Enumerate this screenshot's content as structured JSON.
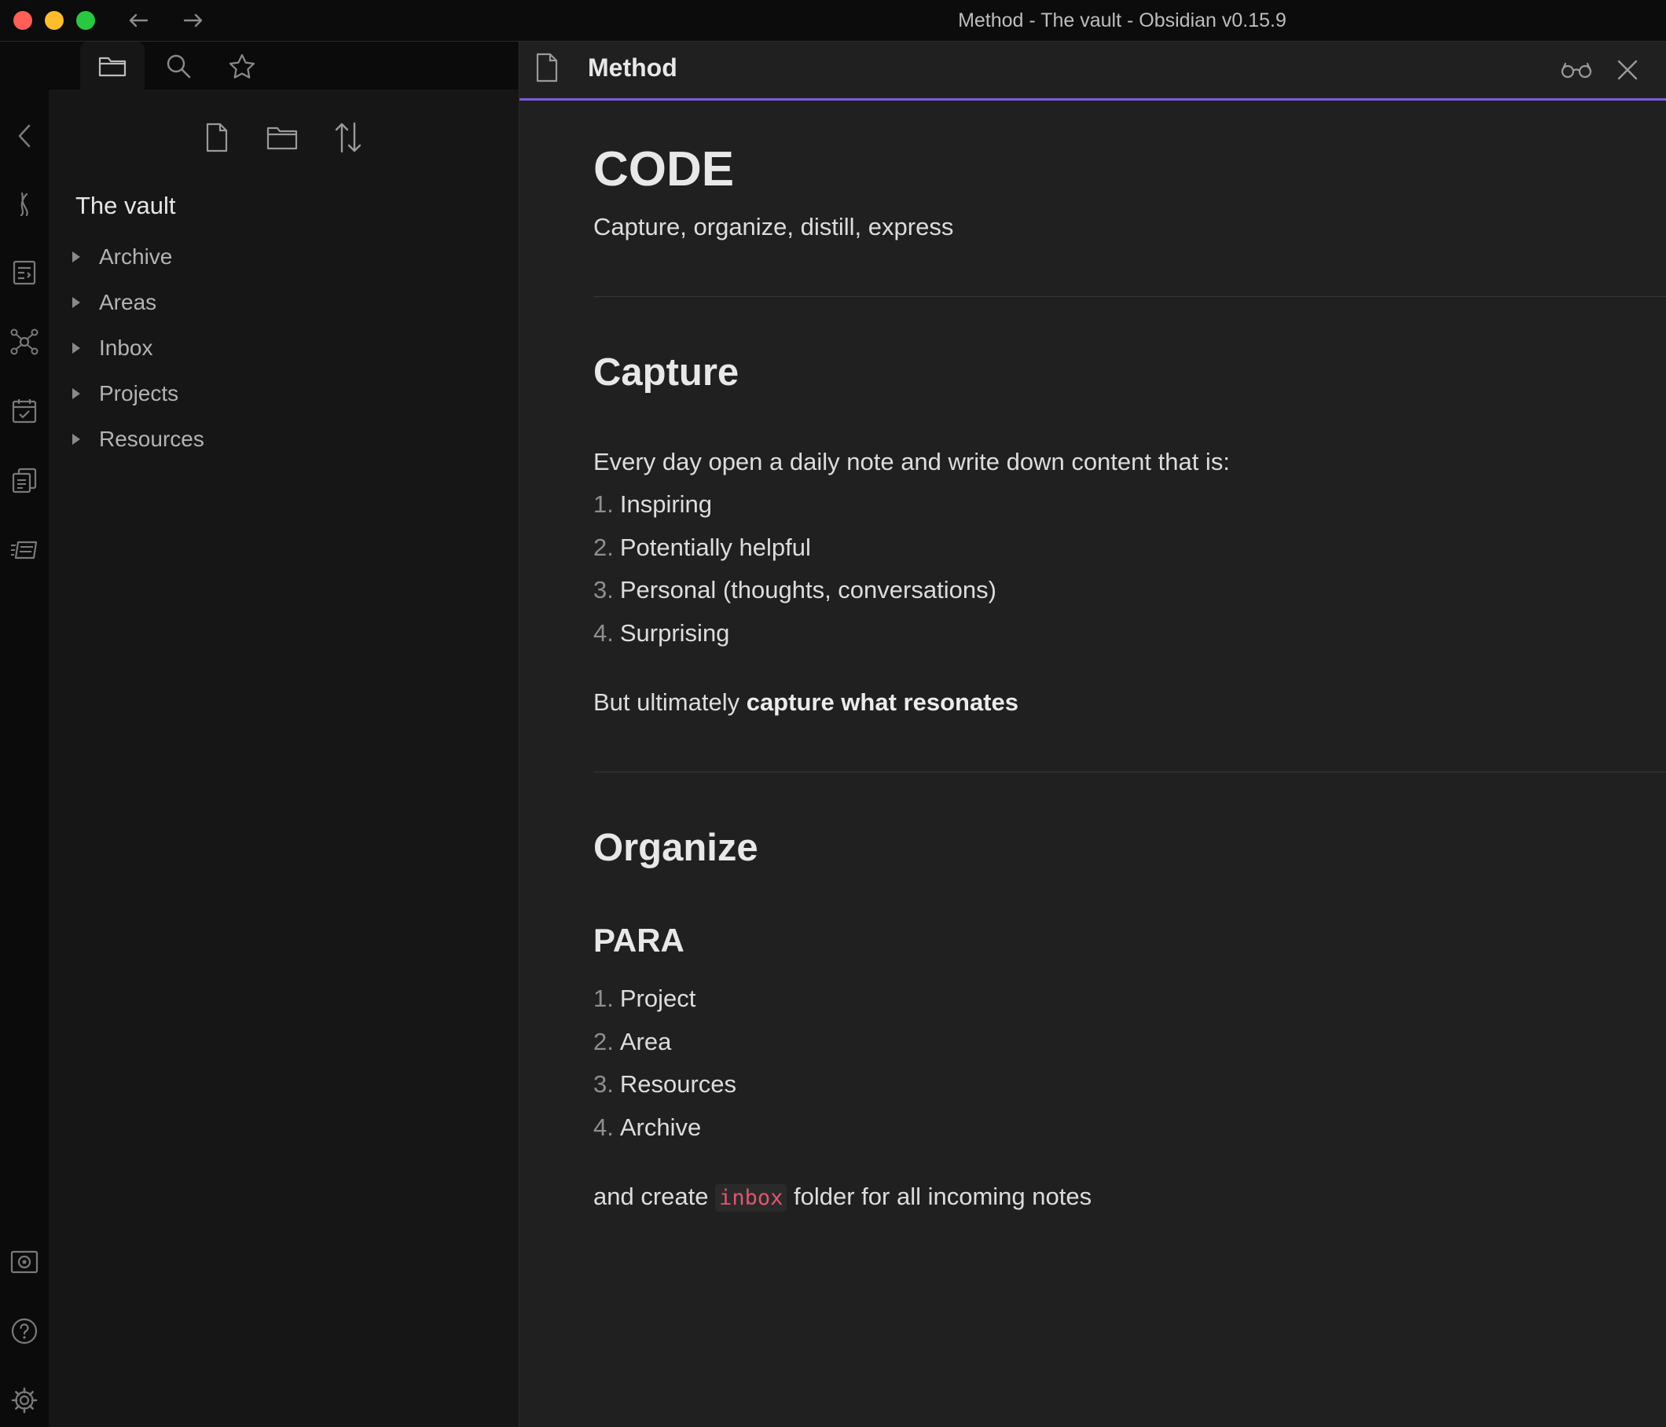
{
  "window": {
    "title": "Method - The vault - Obsidian v0.15.9"
  },
  "ribbon": {
    "icons": [
      "collapse-chevron-icon",
      "quickswitch-icon",
      "command-palette-icon",
      "graph-icon",
      "daily-note-icon",
      "templates-icon",
      "slides-icon",
      "vault-icon",
      "help-icon",
      "settings-icon"
    ]
  },
  "sidebar": {
    "tabs": [
      "file-explorer",
      "search",
      "starred"
    ],
    "vault_name": "The vault",
    "folders": [
      "Archive",
      "Areas",
      "Inbox",
      "Projects",
      "Resources"
    ]
  },
  "note": {
    "tab_title": "Method",
    "h1": "CODE",
    "subtitle": "Capture, organize, distill, express",
    "capture": {
      "heading": "Capture",
      "intro": "Every day open a daily note and write down content that is:",
      "items": [
        "Inspiring",
        "Potentially helpful",
        "Personal (thoughts, conversations)",
        "Surprising"
      ],
      "numbers": [
        "1.",
        "2.",
        "3.",
        "4."
      ],
      "closing_prefix": "But ultimately ",
      "closing_bold": "capture what resonates"
    },
    "organize": {
      "heading": "Organize",
      "subheading": "PARA",
      "items": [
        "Project",
        "Area",
        "Resources",
        "Archive"
      ],
      "numbers": [
        "1.",
        "2.",
        "3.",
        "4."
      ],
      "closing_prefix": "and create ",
      "closing_code": "inbox",
      "closing_suffix": " folder for all incoming notes"
    }
  },
  "colors": {
    "accent": "#7c5cd6",
    "code_text": "#e0566e",
    "background": "#202020",
    "sidebar": "#161616",
    "ribbon": "#0b0b0b"
  }
}
